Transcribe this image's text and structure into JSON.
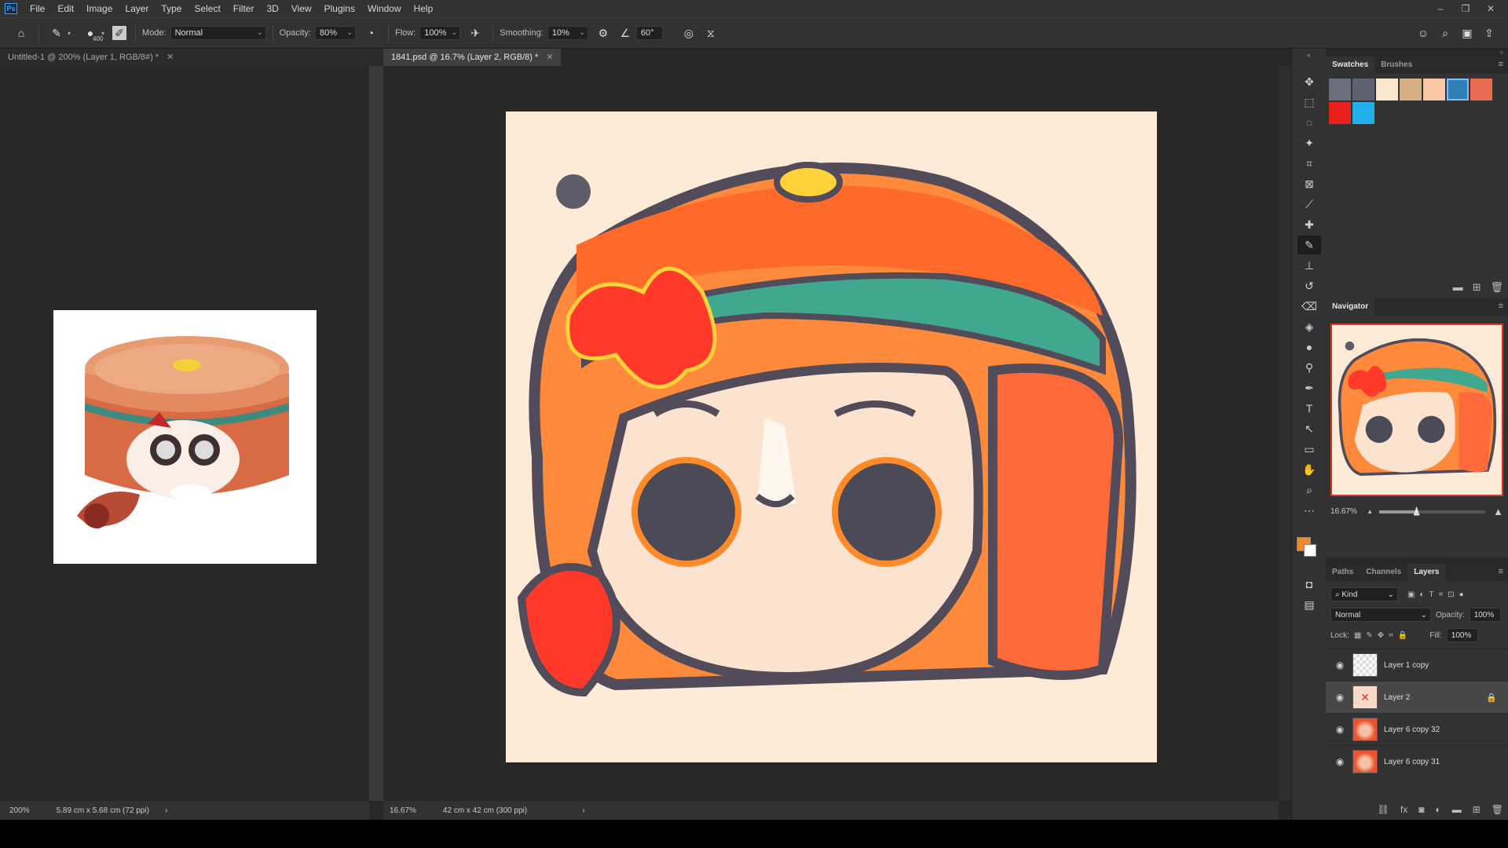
{
  "menu": {
    "logo": "Ps",
    "items": [
      "File",
      "Edit",
      "Image",
      "Layer",
      "Type",
      "Select",
      "Filter",
      "3D",
      "View",
      "Plugins",
      "Window",
      "Help"
    ],
    "window_controls": [
      "–",
      "❐",
      "✕"
    ]
  },
  "options": {
    "brush_size": "400",
    "mode_label": "Mode:",
    "mode_value": "Normal",
    "opacity_label": "Opacity:",
    "opacity_value": "80%",
    "flow_label": "Flow:",
    "flow_value": "100%",
    "smoothing_label": "Smoothing:",
    "smoothing_value": "10%",
    "angle_value": "60°"
  },
  "documents": {
    "left_tab": "Untitled-1 @ 200% (Layer 1, RGB/8#) *",
    "right_tab": "1841.psd @ 16.7% (Layer 2, RGB/8) *",
    "left_status_zoom": "200%",
    "left_status_info": "5.89 cm x 5.68 cm (72 ppi)",
    "right_status_zoom": "16.67%",
    "right_status_info": "42 cm x 42 cm (300 ppi)"
  },
  "swatches_panel": {
    "tabs": [
      "Swatches",
      "Brushes"
    ],
    "colors": [
      "#6b6f7e",
      "#5f6270",
      "#f9e7cd",
      "#d6ad85",
      "#f7c7a4",
      "#2f7fb8",
      "#e86b4f",
      "#e8221a",
      "#22b0ea"
    ],
    "selected_index": 5
  },
  "navigator": {
    "title": "Navigator",
    "zoom": "16.67%",
    "zoom_level": 0.35
  },
  "layers": {
    "tabs": [
      "Paths",
      "Channels",
      "Layers"
    ],
    "filter_label": "Kind",
    "blend_mode": "Normal",
    "opacity_label": "Opacity:",
    "opacity_value": "100%",
    "lock_label": "Lock:",
    "fill_label": "Fill:",
    "fill_value": "100%",
    "items": [
      {
        "name": "Layer 1 copy"
      },
      {
        "name": "Layer 2"
      },
      {
        "name": "Layer 6 copy 32"
      },
      {
        "name": "Layer 6 copy 31"
      }
    ]
  },
  "colors": {
    "foreground": "#f08a2a",
    "background": "#ffffff",
    "accent": "#31a8ff"
  }
}
